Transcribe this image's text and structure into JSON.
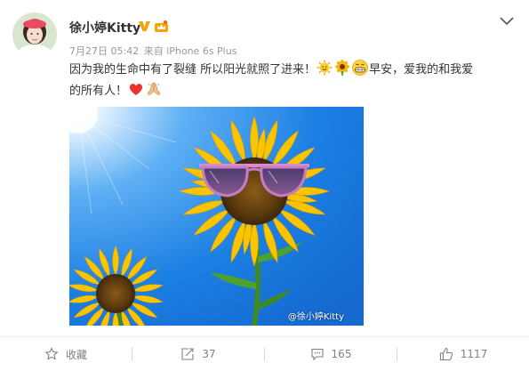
{
  "post": {
    "username": "徐小婷Kitty",
    "time": "7月27日 05:42",
    "source": "来自 iPhone 6s Plus",
    "line1_text": "因为我的生命中有了裂缝 所以阳光就照了进来！",
    "line1_tail": "早安，爱我的和我爱",
    "line2_text": "的所有人！",
    "emoticons": [
      "sun-face-icon",
      "sunflower-icon",
      "grin-face-icon",
      "red-heart-icon",
      "folded-hands-icon"
    ],
    "watermark": "@徐小婷Kitty"
  },
  "actions": {
    "favorite_label": "收藏",
    "repost_count": "37",
    "comment_count": "165",
    "like_count": "1117"
  },
  "colors": {
    "accent_orange": "#f7a400",
    "sky_blue": "#1e7fe0",
    "icon_gray": "#808080"
  }
}
